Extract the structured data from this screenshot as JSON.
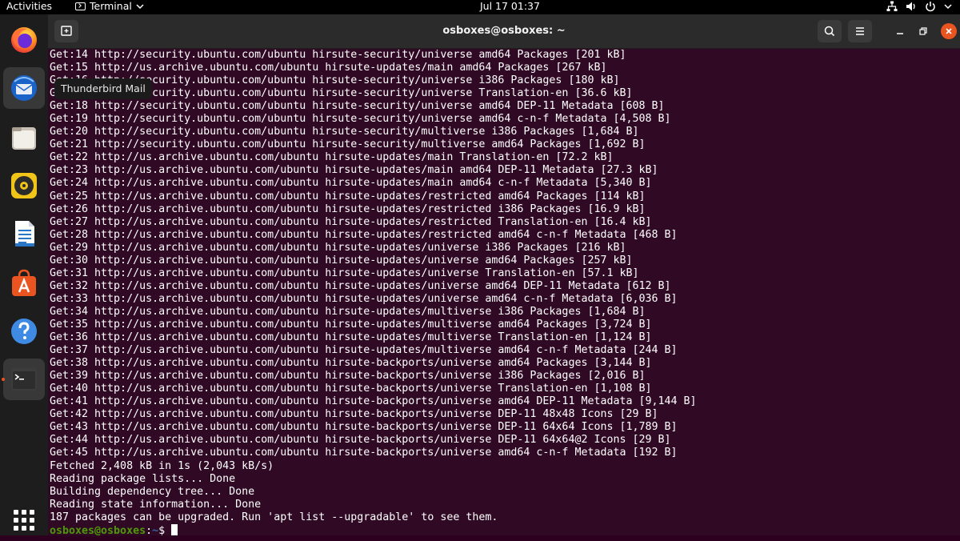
{
  "topbar": {
    "activities": "Activities",
    "app_name": "Terminal",
    "clock": "Jul 17  01:37",
    "tray_icons": [
      "network-icon",
      "volume-icon",
      "power-icon"
    ]
  },
  "dock": {
    "tooltip": "Thunderbird Mail",
    "items": [
      {
        "name": "firefox-icon"
      },
      {
        "name": "thunderbird-icon"
      },
      {
        "name": "files-icon"
      },
      {
        "name": "rhythmbox-icon"
      },
      {
        "name": "writer-icon"
      },
      {
        "name": "software-icon"
      },
      {
        "name": "help-icon"
      },
      {
        "name": "terminal-icon"
      },
      {
        "name": "app-grid-icon"
      }
    ]
  },
  "window": {
    "title": "osboxes@osboxes: ~",
    "accent": "#e95420"
  },
  "terminal": {
    "lines": [
      "Get:14 http://security.ubuntu.com/ubuntu hirsute-security/universe amd64 Packages [201 kB]",
      "Get:15 http://us.archive.ubuntu.com/ubuntu hirsute-updates/main amd64 Packages [267 kB]",
      "Get:16 http://security.ubuntu.com/ubuntu hirsute-security/universe i386 Packages [180 kB]",
      "Get:17 http://security.ubuntu.com/ubuntu hirsute-security/universe Translation-en [36.6 kB]",
      "Get:18 http://security.ubuntu.com/ubuntu hirsute-security/universe amd64 DEP-11 Metadata [608 B]",
      "Get:19 http://security.ubuntu.com/ubuntu hirsute-security/universe amd64 c-n-f Metadata [4,508 B]",
      "Get:20 http://security.ubuntu.com/ubuntu hirsute-security/multiverse i386 Packages [1,684 B]",
      "Get:21 http://security.ubuntu.com/ubuntu hirsute-security/multiverse amd64 Packages [1,692 B]",
      "Get:22 http://us.archive.ubuntu.com/ubuntu hirsute-updates/main Translation-en [72.2 kB]",
      "Get:23 http://us.archive.ubuntu.com/ubuntu hirsute-updates/main amd64 DEP-11 Metadata [27.3 kB]",
      "Get:24 http://us.archive.ubuntu.com/ubuntu hirsute-updates/main amd64 c-n-f Metadata [5,340 B]",
      "Get:25 http://us.archive.ubuntu.com/ubuntu hirsute-updates/restricted amd64 Packages [114 kB]",
      "Get:26 http://us.archive.ubuntu.com/ubuntu hirsute-updates/restricted i386 Packages [16.9 kB]",
      "Get:27 http://us.archive.ubuntu.com/ubuntu hirsute-updates/restricted Translation-en [16.4 kB]",
      "Get:28 http://us.archive.ubuntu.com/ubuntu hirsute-updates/restricted amd64 c-n-f Metadata [468 B]",
      "Get:29 http://us.archive.ubuntu.com/ubuntu hirsute-updates/universe i386 Packages [216 kB]",
      "Get:30 http://us.archive.ubuntu.com/ubuntu hirsute-updates/universe amd64 Packages [257 kB]",
      "Get:31 http://us.archive.ubuntu.com/ubuntu hirsute-updates/universe Translation-en [57.1 kB]",
      "Get:32 http://us.archive.ubuntu.com/ubuntu hirsute-updates/universe amd64 DEP-11 Metadata [612 B]",
      "Get:33 http://us.archive.ubuntu.com/ubuntu hirsute-updates/universe amd64 c-n-f Metadata [6,036 B]",
      "Get:34 http://us.archive.ubuntu.com/ubuntu hirsute-updates/multiverse i386 Packages [1,684 B]",
      "Get:35 http://us.archive.ubuntu.com/ubuntu hirsute-updates/multiverse amd64 Packages [3,724 B]",
      "Get:36 http://us.archive.ubuntu.com/ubuntu hirsute-updates/multiverse Translation-en [1,124 B]",
      "Get:37 http://us.archive.ubuntu.com/ubuntu hirsute-updates/multiverse amd64 c-n-f Metadata [244 B]",
      "Get:38 http://us.archive.ubuntu.com/ubuntu hirsute-backports/universe amd64 Packages [3,144 B]",
      "Get:39 http://us.archive.ubuntu.com/ubuntu hirsute-backports/universe i386 Packages [2,016 B]",
      "Get:40 http://us.archive.ubuntu.com/ubuntu hirsute-backports/universe Translation-en [1,108 B]",
      "Get:41 http://us.archive.ubuntu.com/ubuntu hirsute-backports/universe amd64 DEP-11 Metadata [9,144 B]",
      "Get:42 http://us.archive.ubuntu.com/ubuntu hirsute-backports/universe DEP-11 48x48 Icons [29 B]",
      "Get:43 http://us.archive.ubuntu.com/ubuntu hirsute-backports/universe DEP-11 64x64 Icons [1,789 B]",
      "Get:44 http://us.archive.ubuntu.com/ubuntu hirsute-backports/universe DEP-11 64x64@2 Icons [29 B]",
      "Get:45 http://us.archive.ubuntu.com/ubuntu hirsute-backports/universe amd64 c-n-f Metadata [192 B]",
      "Fetched 2,408 kB in 1s (2,043 kB/s)",
      "Reading package lists... Done",
      "Building dependency tree... Done",
      "Reading state information... Done",
      "187 packages can be upgraded. Run 'apt list --upgradable' to see them."
    ],
    "prompt_user": "osboxes@osboxes",
    "prompt_sep": ":",
    "prompt_path": "~",
    "prompt_symbol": "$ "
  }
}
